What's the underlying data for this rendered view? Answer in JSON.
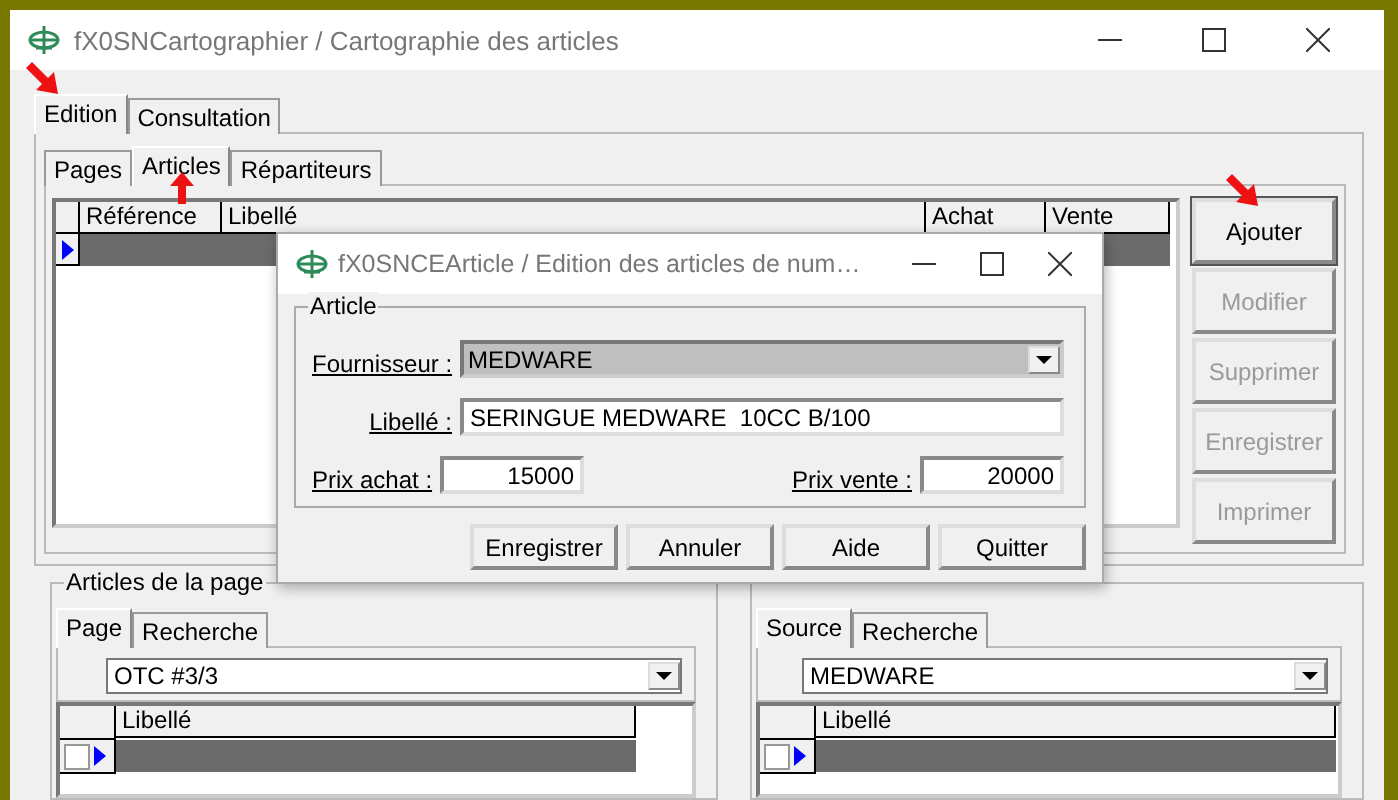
{
  "window": {
    "title": "fX0SNCartographier / Cartographie des articles"
  },
  "tabs": [
    {
      "label": "Edition",
      "selected": true
    },
    {
      "label": "Consultation",
      "selected": false
    }
  ],
  "subtabs": [
    {
      "label": "Pages",
      "selected": false
    },
    {
      "label": "Articles",
      "selected": true
    },
    {
      "label": "Répartiteurs",
      "selected": false
    }
  ],
  "grid": {
    "columns": [
      "Référence",
      "Libellé",
      "Achat",
      "Vente"
    ],
    "rows": [
      {
        "selected": true
      }
    ]
  },
  "actions": [
    {
      "label": "Ajouter",
      "disabled": false
    },
    {
      "label": "Modifier",
      "disabled": true
    },
    {
      "label": "Supprimer",
      "disabled": true
    },
    {
      "label": "Enregistrer",
      "disabled": true
    },
    {
      "label": "Imprimer",
      "disabled": true
    }
  ],
  "panels": [
    {
      "title": "Articles de la page",
      "tabs": [
        {
          "label": "Page",
          "selected": true
        },
        {
          "label": "Recherche",
          "selected": false
        }
      ],
      "combo": "OTC #3/3",
      "columns": [
        "Libellé"
      ],
      "rows": [
        {
          "selected": true,
          "checked": false
        }
      ]
    },
    {
      "tabs": [
        {
          "label": "Source",
          "selected": true
        },
        {
          "label": "Recherche",
          "selected": false
        }
      ],
      "combo": "MEDWARE",
      "columns": [
        "Libellé"
      ],
      "rows": [
        {
          "selected": true,
          "checked": false
        }
      ]
    }
  ],
  "dialog": {
    "title": "fX0SNCEArticle / Edition des articles de num…",
    "group": "Article",
    "fields": [
      {
        "kind": "combo",
        "label": "Fournisseur :",
        "value": "MEDWARE"
      },
      {
        "kind": "text",
        "label": "Libellé :",
        "value": "SERINGUE MEDWARE  10CC B/100"
      }
    ],
    "prices": [
      {
        "label": "Prix achat :",
        "value": "15000"
      },
      {
        "label": "Prix vente :",
        "value": "20000"
      }
    ],
    "buttons": [
      "Enregistrer",
      "Annuler",
      "Aide",
      "Quitter"
    ]
  }
}
